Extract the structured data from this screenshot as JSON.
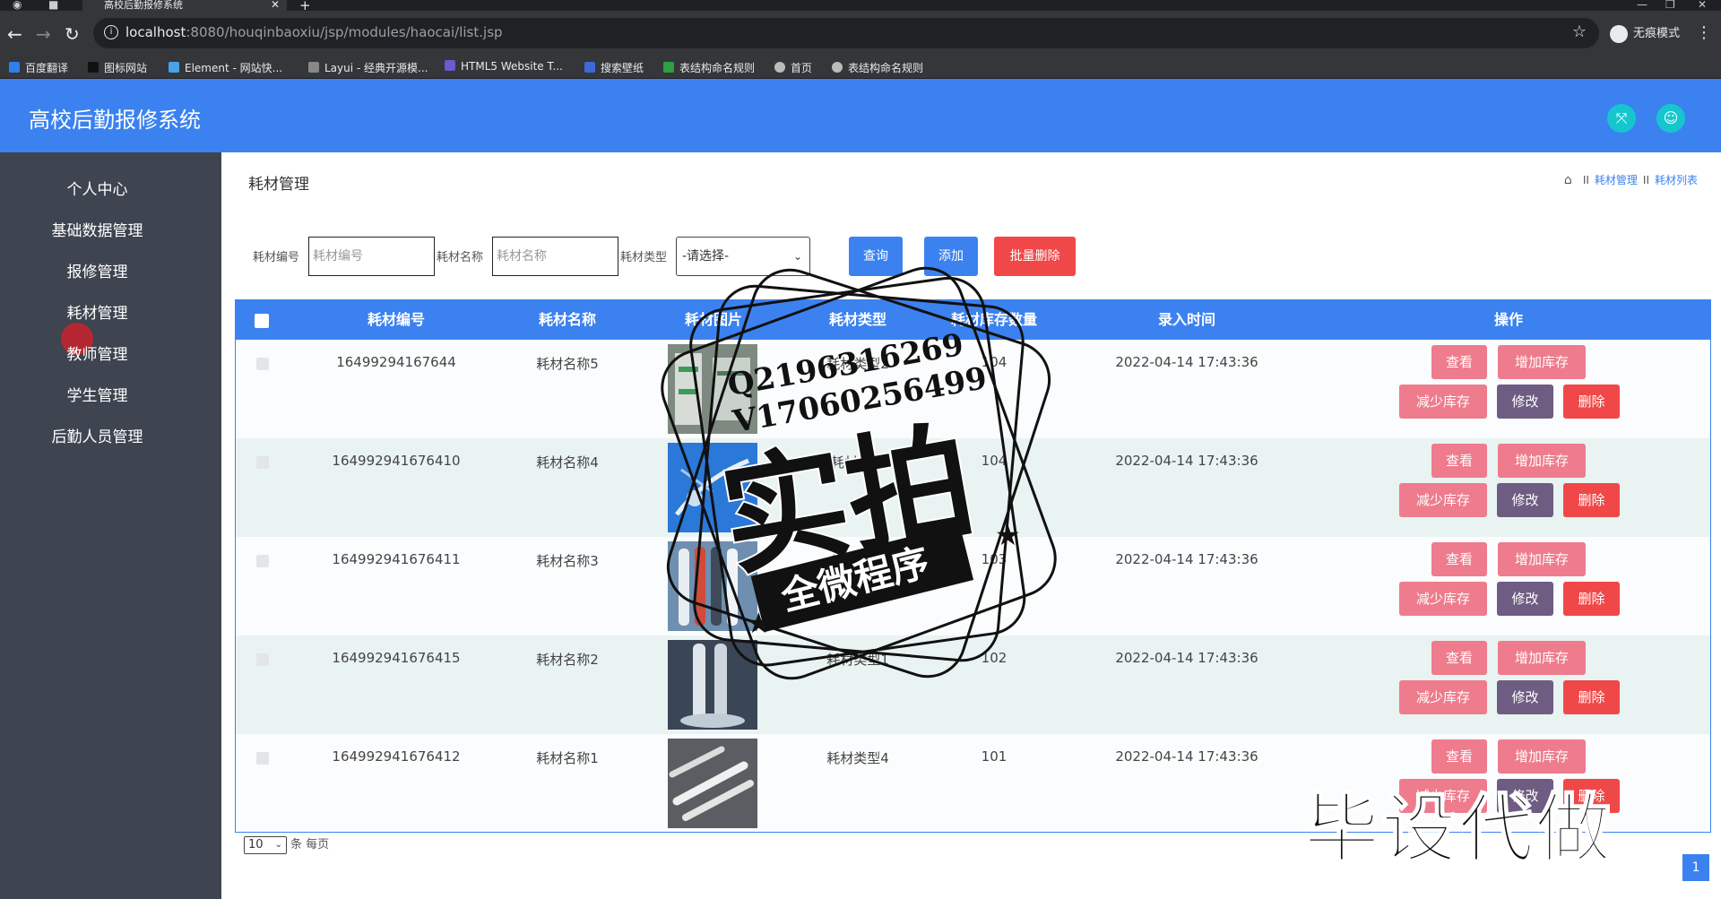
{
  "browser": {
    "tab_title": "高校后勤报修系统",
    "url_host": "localhost",
    "url_rest": ":8080/houqinbaoxiu/jsp/modules/haocai/list.jsp",
    "profile_label": "无痕模式",
    "bookmarks": [
      "百度翻译",
      "图标网站",
      "Element - 网站快...",
      "Layui - 经典开源模...",
      "HTML5 Website T...",
      "搜索壁纸",
      "表结构命名规则",
      "首页",
      "表结构命名规则"
    ]
  },
  "app": {
    "title": "高校后勤报修系统"
  },
  "sidebar": {
    "items": [
      {
        "label": "个人中心"
      },
      {
        "label": "基础数据管理"
      },
      {
        "label": "报修管理"
      },
      {
        "label": "耗材管理"
      },
      {
        "label": "教师管理"
      },
      {
        "label": "学生管理"
      },
      {
        "label": "后勤人员管理"
      }
    ]
  },
  "page": {
    "title": "耗材管理",
    "breadcrumb": [
      "耗材管理",
      "耗材列表"
    ],
    "breadcrumb_sep": "II"
  },
  "filters": {
    "code_label": "耗材编号",
    "code_placeholder": "耗材编号",
    "name_label": "耗材名称",
    "name_placeholder": "耗材名称",
    "type_label": "耗材类型",
    "type_selected": "-请选择-",
    "query_btn": "查询",
    "add_btn": "添加",
    "batch_delete_btn": "批量删除"
  },
  "table": {
    "headers": [
      "耗材编号",
      "耗材名称",
      "耗材图片",
      "耗材类型",
      "耗材库存数量",
      "录入时间",
      "操作"
    ],
    "actions": {
      "view": "查看",
      "increase": "增加库存",
      "decrease": "减少库存",
      "edit": "修改",
      "delete": "删除"
    },
    "rows": [
      {
        "code": "16499294167644",
        "name": "耗材名称5",
        "type": "耗材类型2",
        "stock": "104",
        "time": "2022-04-14 17:43:36"
      },
      {
        "code": "164992941676410",
        "name": "耗材名称4",
        "type": "耗材类型",
        "stock": "104",
        "time": "2022-04-14 17:43:36"
      },
      {
        "code": "164992941676411",
        "name": "耗材名称3",
        "type": "耗材类型",
        "stock": "103",
        "time": "2022-04-14 17:43:36"
      },
      {
        "code": "164992941676415",
        "name": "耗材名称2",
        "type": "耗材类型1",
        "stock": "102",
        "time": "2022-04-14 17:43:36"
      },
      {
        "code": "164992941676412",
        "name": "耗材名称1",
        "type": "耗材类型4",
        "stock": "101",
        "time": "2022-04-14 17:43:36"
      }
    ]
  },
  "pagination": {
    "page_size": "10",
    "per_page_label": "条 每页",
    "current_page": "1"
  },
  "watermark": {
    "qq": "Q2196316269",
    "wx": "V17060256499",
    "big": "实拍",
    "ribbon": "全微程序",
    "bottom": "毕设代做"
  },
  "colors": {
    "primary": "#3b82f0",
    "sidebar": "#3e4450",
    "danger": "#f04848",
    "pink": "#ee7c8c",
    "purple": "#6e5c82",
    "teal": "#16c6cf"
  }
}
